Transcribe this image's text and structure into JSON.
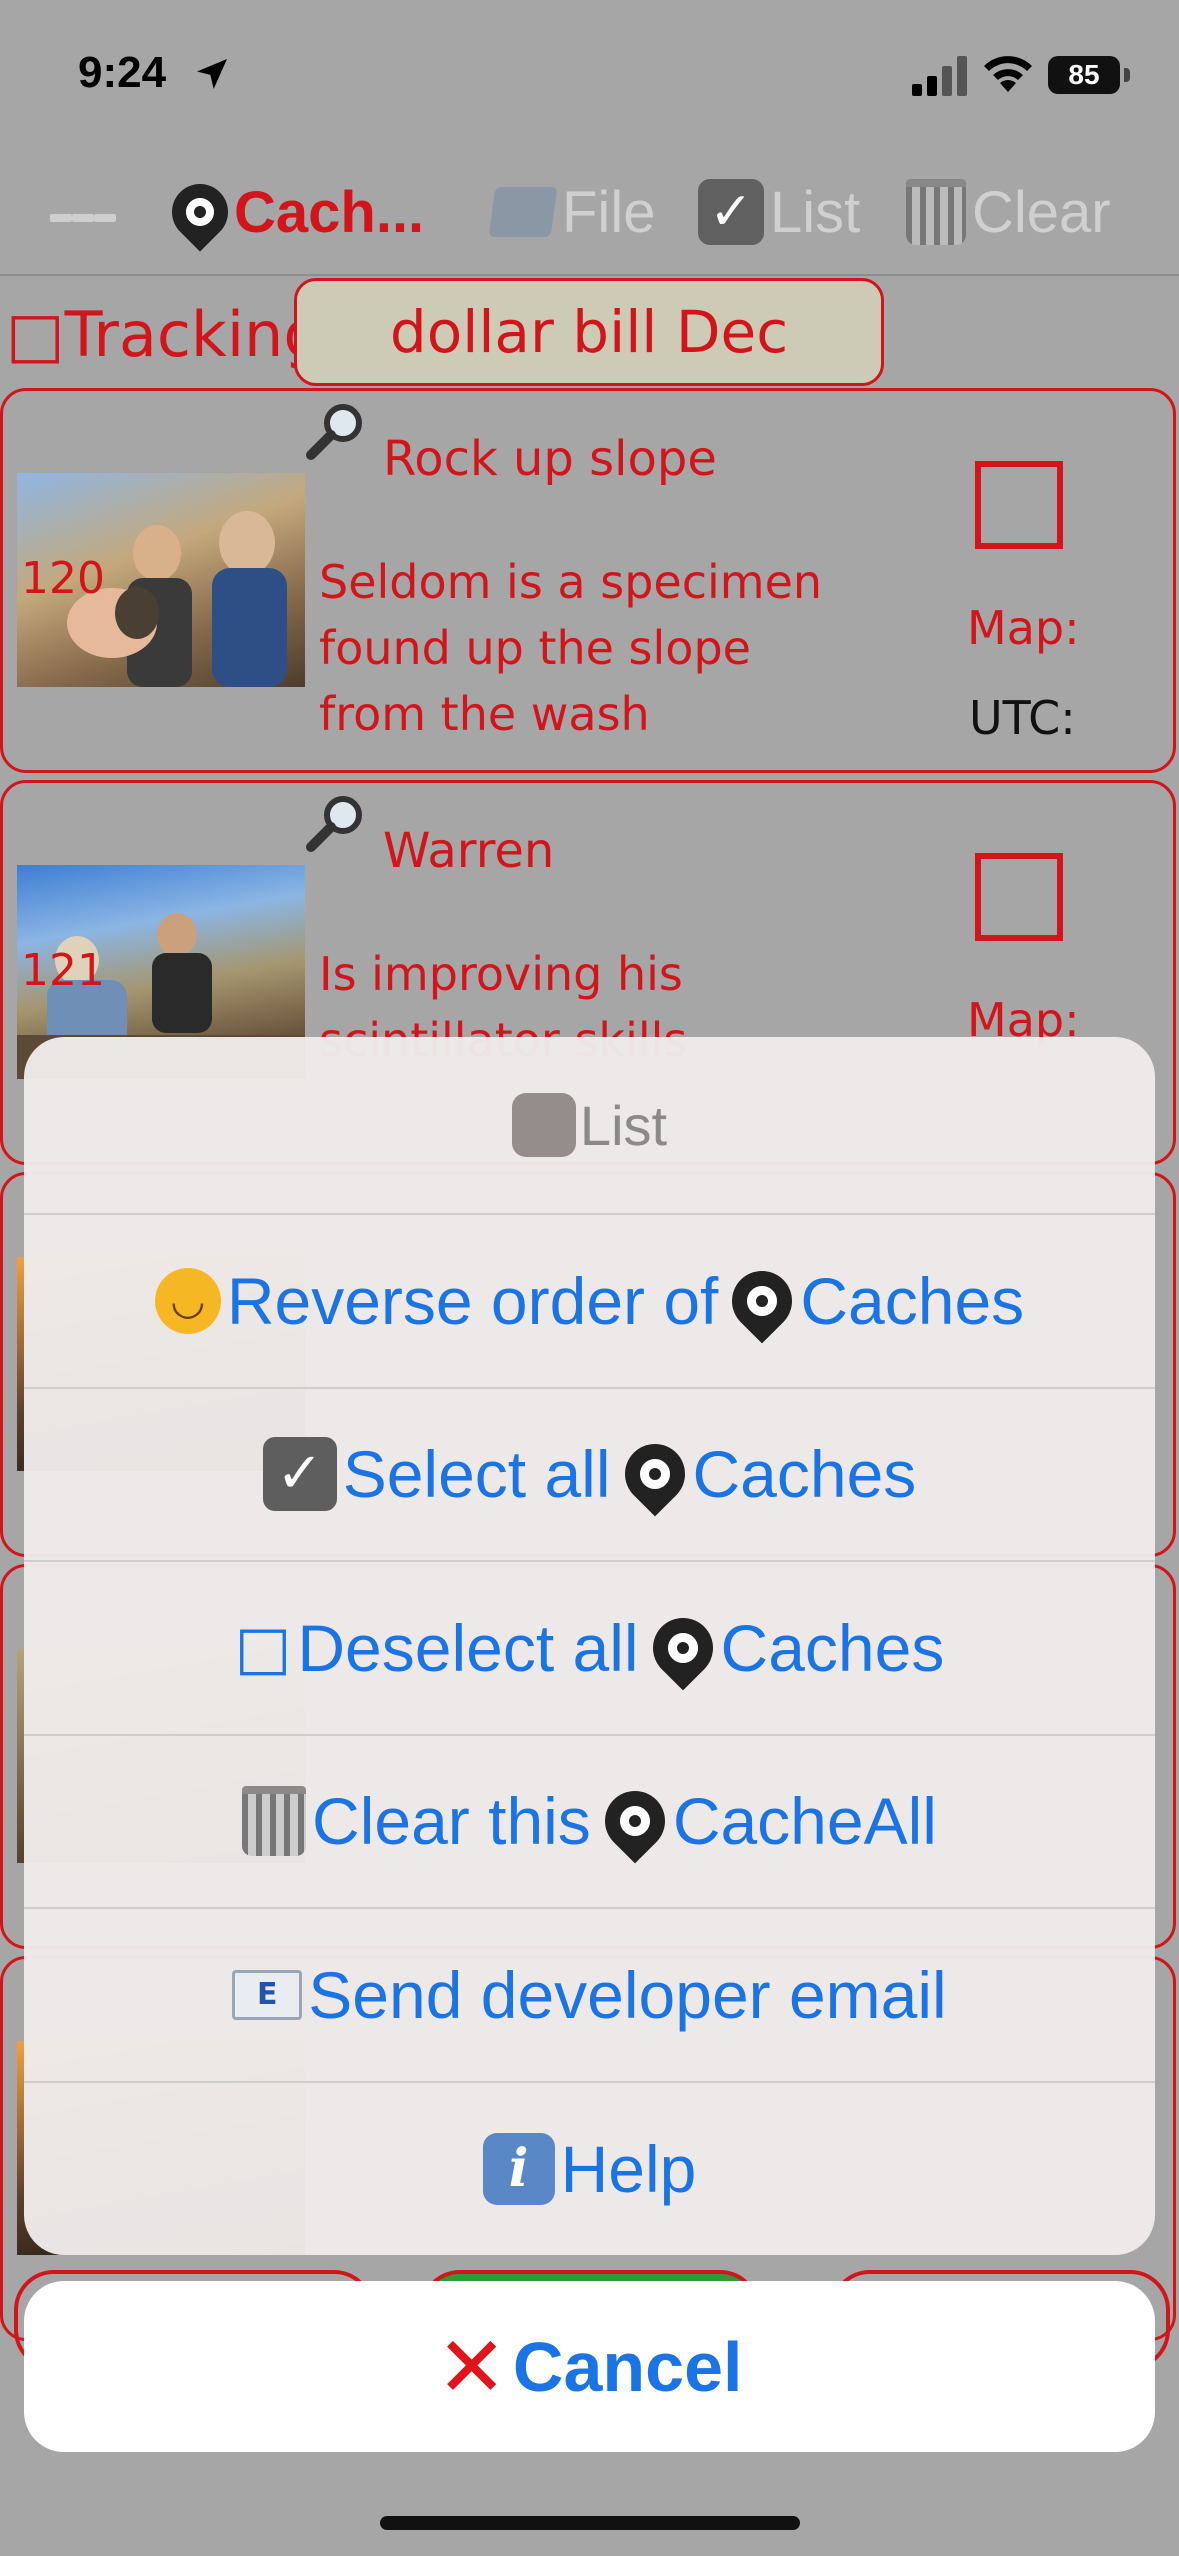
{
  "status_bar": {
    "time": "9:24",
    "battery": "85"
  },
  "toolbar": {
    "cache_tab": "Cach...",
    "file_tab": "File",
    "list_tab": "List",
    "clear_tab": "Clear"
  },
  "tracking": {
    "label": "□Tracking",
    "value": "dollar bill Dec"
  },
  "cards": [
    {
      "number": "120",
      "title": "Rock up slope",
      "description": "Seldom is a specimen found up the slope from the wash",
      "map_label": "Map:",
      "utc_label": "UTC:"
    },
    {
      "number": "121",
      "title": "Warren",
      "description": "Is improving his scintillator skills",
      "map_label": "Map:"
    }
  ],
  "action_sheet": {
    "title": "List",
    "items": [
      {
        "icon": "upside-down-face-icon",
        "label": "Reverse order of ",
        "suffix": "Caches"
      },
      {
        "icon": "checkbox-checked-icon",
        "label": "Select all ",
        "suffix": "Caches"
      },
      {
        "icon": "checkbox-empty-icon",
        "label": "Deselect all ",
        "suffix": "Caches"
      },
      {
        "icon": "wastebasket-icon",
        "label": "Clear this ",
        "suffix": "CacheAll"
      },
      {
        "icon": "email-icon",
        "label": "Send developer email"
      },
      {
        "icon": "info-icon",
        "label": "Help"
      }
    ],
    "cancel": "Cancel"
  },
  "colors": {
    "accent_red": "#d2151b",
    "ios_blue": "#1b74e4",
    "dim_background": "#a6a6a6"
  }
}
